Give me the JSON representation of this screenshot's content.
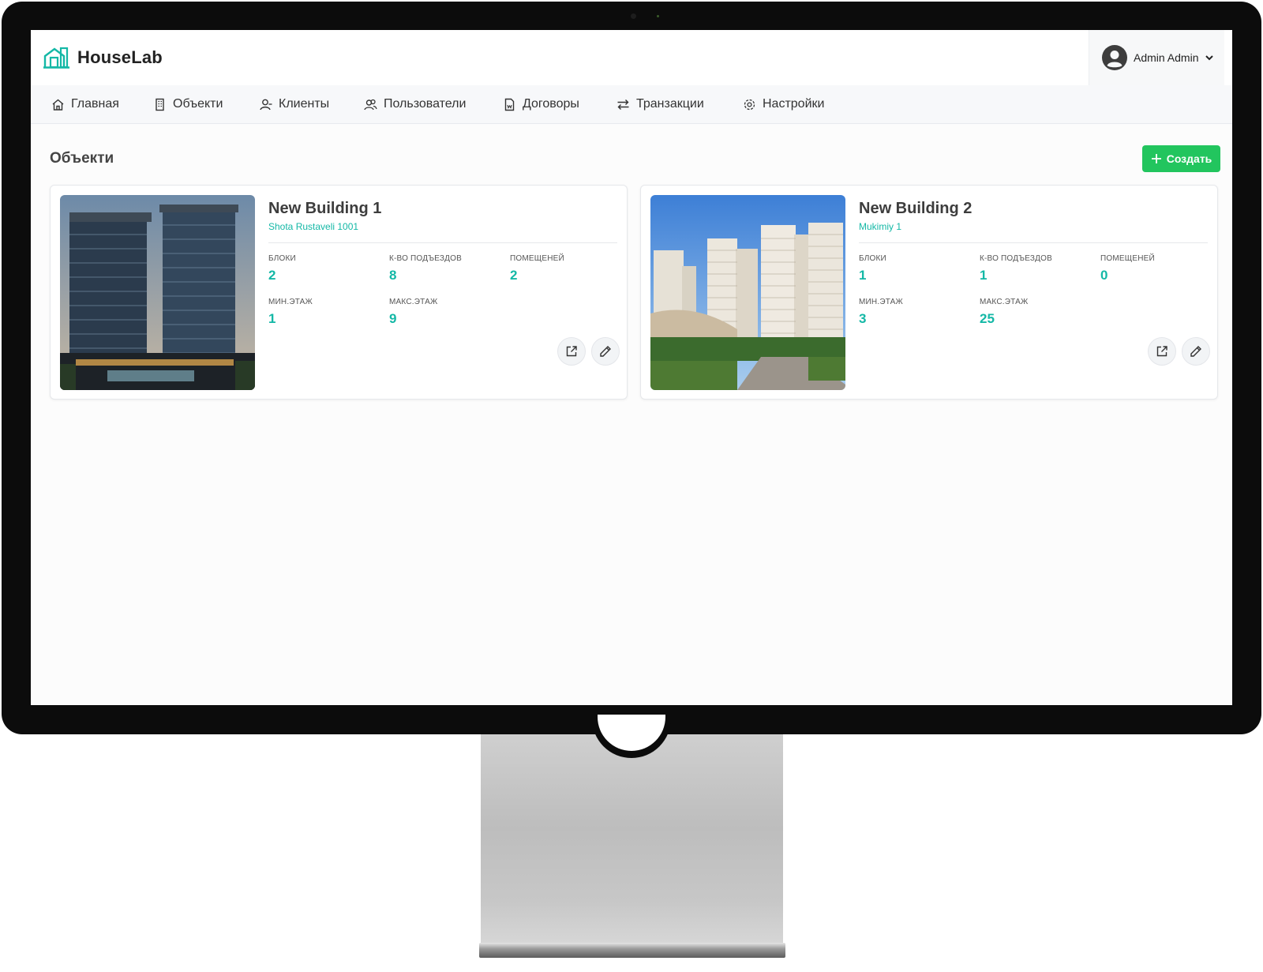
{
  "app": {
    "brand": "HouseLab"
  },
  "user": {
    "name": "Admin Admin"
  },
  "nav": [
    {
      "label": "Главная",
      "icon": "home-icon"
    },
    {
      "label": "Объекти",
      "icon": "building-icon"
    },
    {
      "label": "Клиенты",
      "icon": "user-icon"
    },
    {
      "label": "Пользователи",
      "icon": "users-icon"
    },
    {
      "label": "Договоры",
      "icon": "document-icon"
    },
    {
      "label": "Транзакции",
      "icon": "transfer-icon"
    },
    {
      "label": "Настройки",
      "icon": "gear-icon"
    }
  ],
  "page": {
    "title": "Объекти",
    "create_label": "Создать"
  },
  "labels": {
    "blocks": "Блоки",
    "entrances": "К-во подъездов",
    "rooms": "Помещеней",
    "min_floor": "Мин.этаж",
    "max_floor": "Макс.этаж"
  },
  "buildings": [
    {
      "name": "New Building 1",
      "address": "Shota Rustaveli 1001",
      "blocks": "2",
      "entrances": "8",
      "rooms": "2",
      "min_floor": "1",
      "max_floor": "9"
    },
    {
      "name": "New Building 2",
      "address": "Mukimiy 1",
      "blocks": "1",
      "entrances": "1",
      "rooms": "0",
      "min_floor": "3",
      "max_floor": "25"
    }
  ],
  "colors": {
    "accent": "#14b8a6",
    "create_button": "#22c55e"
  }
}
